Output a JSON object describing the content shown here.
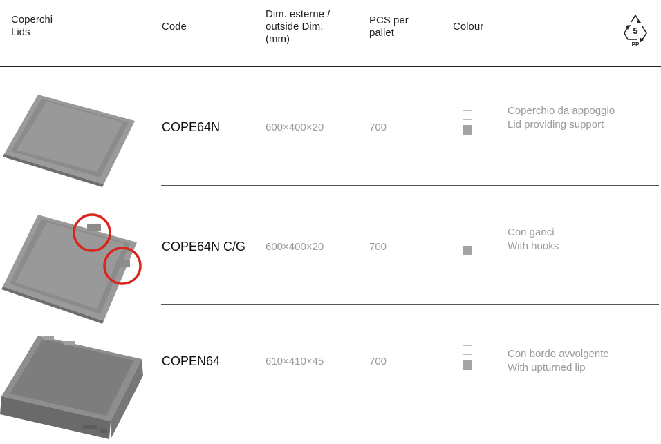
{
  "header": {
    "col1": "Coperchi\nLids",
    "col2": "Code",
    "col3": "Dim. esterne /\noutside Dim.\n(mm)",
    "col4": "PCS per\npallet",
    "col5": "Colour",
    "recycle_number": "5",
    "recycle_material": "PP"
  },
  "rows": [
    {
      "code": "COPE64N",
      "dim": "600×400×20",
      "pcs": "700",
      "desc_it": "Coperchio da appoggio",
      "desc_en": "Lid providing support"
    },
    {
      "code": "COPE64N C/G",
      "dim": "600×400×20",
      "pcs": "700",
      "desc_it": "Con ganci",
      "desc_en": "With hooks"
    },
    {
      "code": "COPEN64",
      "dim": "610×410×45",
      "pcs": "700",
      "desc_it": "Con bordo avvolgente",
      "desc_en": "With upturned lip"
    }
  ],
  "colors": {
    "swatch_white": "#ffffff",
    "swatch_grey": "#a3a3a3",
    "highlight": "#d9261c",
    "lid_grey": "#8e8e8e"
  },
  "icons": {
    "recycle": "recycle-pp-icon",
    "hook_marker": "red-circle-highlight"
  }
}
